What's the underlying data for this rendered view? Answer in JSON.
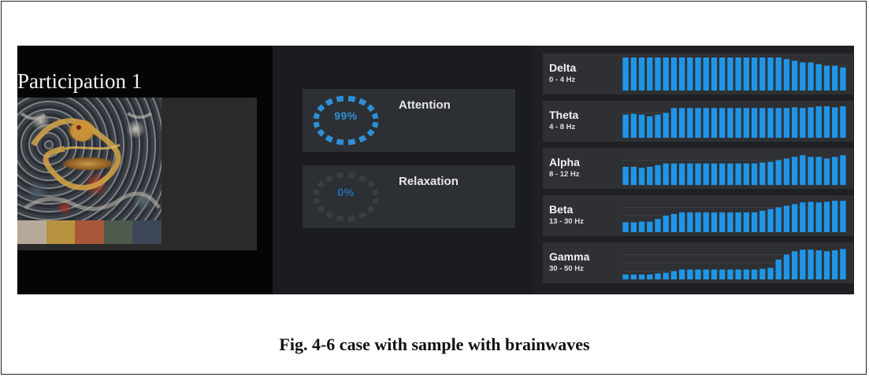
{
  "participant": {
    "title": "Participation 1"
  },
  "sample": {
    "image_name": "embroidered-dragon-textile",
    "swatches": [
      "#b7a99a",
      "#b8933f",
      "#a9573a",
      "#4d5a4d",
      "#3d4656"
    ]
  },
  "metrics": [
    {
      "label": "Attention",
      "value_text": "99%",
      "value": 99,
      "color": "#2e8fd6"
    },
    {
      "label": "Relaxation",
      "value_text": "0%",
      "value": 0,
      "color": "#1f6fb0"
    }
  ],
  "bands": [
    {
      "name": "Delta",
      "range": "0 - 4 Hz",
      "levels": [
        1.0,
        1.0,
        1.0,
        1.0,
        1.0,
        1.0,
        1.0,
        1.0,
        1.0,
        1.0,
        1.0,
        1.0,
        1.0,
        1.0,
        1.0,
        1.0,
        1.0,
        1.0,
        1.0,
        1.0,
        0.95,
        0.9,
        0.85,
        0.85,
        0.8,
        0.75,
        0.75,
        0.7
      ]
    },
    {
      "name": "Theta",
      "range": "4 - 8 Hz",
      "levels": [
        0.7,
        0.72,
        0.7,
        0.65,
        0.7,
        0.75,
        0.9,
        0.9,
        0.9,
        0.9,
        0.9,
        0.9,
        0.9,
        0.9,
        0.9,
        0.9,
        0.9,
        0.9,
        0.9,
        0.9,
        0.9,
        0.92,
        0.9,
        0.92,
        0.95,
        0.95,
        0.92,
        0.95
      ]
    },
    {
      "name": "Alpha",
      "range": "8 - 12 Hz",
      "levels": [
        0.55,
        0.55,
        0.52,
        0.55,
        0.6,
        0.65,
        0.65,
        0.65,
        0.65,
        0.65,
        0.65,
        0.65,
        0.65,
        0.65,
        0.65,
        0.65,
        0.65,
        0.68,
        0.7,
        0.75,
        0.8,
        0.85,
        0.9,
        0.85,
        0.85,
        0.8,
        0.85,
        0.9
      ]
    },
    {
      "name": "Beta",
      "range": "13 - 30 Hz",
      "levels": [
        0.3,
        0.3,
        0.32,
        0.32,
        0.4,
        0.5,
        0.55,
        0.6,
        0.6,
        0.6,
        0.6,
        0.6,
        0.6,
        0.6,
        0.6,
        0.6,
        0.6,
        0.65,
        0.7,
        0.75,
        0.8,
        0.85,
        0.9,
        0.92,
        0.9,
        0.92,
        0.95,
        0.95
      ]
    },
    {
      "name": "Gamma",
      "range": "30 - 50 Hz",
      "levels": [
        0.15,
        0.15,
        0.15,
        0.15,
        0.18,
        0.2,
        0.25,
        0.3,
        0.3,
        0.3,
        0.3,
        0.3,
        0.3,
        0.3,
        0.3,
        0.3,
        0.3,
        0.32,
        0.35,
        0.6,
        0.75,
        0.85,
        0.9,
        0.9,
        0.88,
        0.85,
        0.88,
        0.92
      ]
    }
  ],
  "caption": "Fig. 4-6 case with sample with brainwaves"
}
